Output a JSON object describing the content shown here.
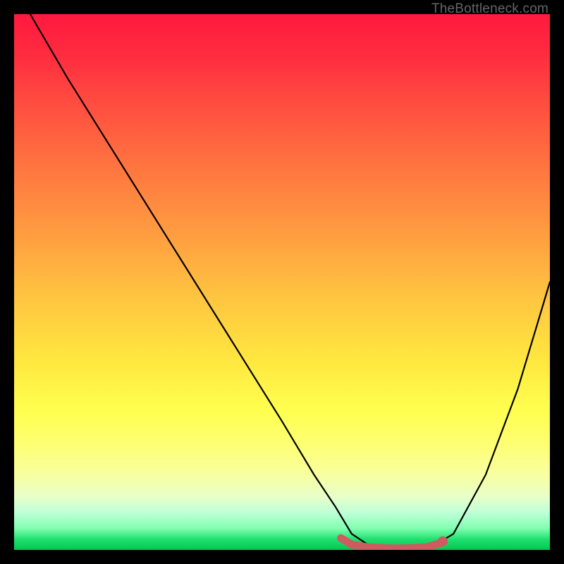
{
  "watermark": "TheBottleneck.com",
  "chart_data": {
    "type": "line",
    "title": "",
    "xlabel": "",
    "ylabel": "",
    "xlim": [
      0,
      100
    ],
    "ylim": [
      0,
      100
    ],
    "series": [
      {
        "name": "bottleneck-curve",
        "x": [
          3,
          10,
          20,
          30,
          40,
          50,
          56,
          60,
          63,
          66,
          70,
          73,
          77,
          82,
          88,
          94,
          100
        ],
        "y": [
          100,
          88,
          72,
          56,
          40,
          24,
          14,
          8,
          3,
          1,
          0,
          0,
          0,
          3,
          14,
          30,
          50
        ]
      }
    ],
    "highlight_segment": {
      "name": "optimal-range",
      "x": [
        61,
        63,
        66,
        70,
        73,
        77,
        80
      ],
      "y": [
        2.2,
        1.0,
        0.5,
        0.3,
        0.3,
        0.5,
        1.4
      ]
    },
    "highlight_dot": {
      "x": 80,
      "y": 1.6
    },
    "colors": {
      "curve": "#000000",
      "highlight": "#cf5a5f",
      "gradient_top": "#ff193f",
      "gradient_bottom": "#00c850"
    }
  }
}
